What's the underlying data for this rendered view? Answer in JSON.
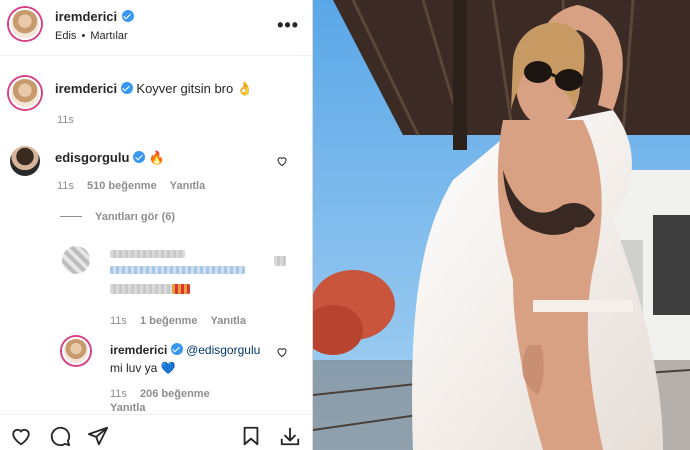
{
  "header": {
    "username": "iremderici",
    "subtitle_user": "Edis",
    "subtitle_sep": "•",
    "subtitle_song": "Martılar",
    "more_label": "•••"
  },
  "caption": {
    "username": "iremderici",
    "text": "Koyver gitsin bro 👌",
    "time": "11s"
  },
  "comment1": {
    "username": "edisgorgulu",
    "text": "🔥",
    "time": "11s",
    "likes": "510 beğenme",
    "reply": "Yanıtla",
    "view_replies": "Yanıtları gör (6)"
  },
  "reply_blurred": {
    "time": "11s",
    "likes": "1 beğenme",
    "reply": "Yanıtla"
  },
  "reply2": {
    "username": "iremderici",
    "mention": "@edisgorgulu",
    "text": "mi luv ya 💙",
    "time": "11s",
    "likes": "206 beğenme",
    "reply": "Yanıtla"
  },
  "colors": {
    "accent_blue": "#3897f0",
    "mention_blue": "#00376b",
    "story_ring": "#d93f83"
  }
}
